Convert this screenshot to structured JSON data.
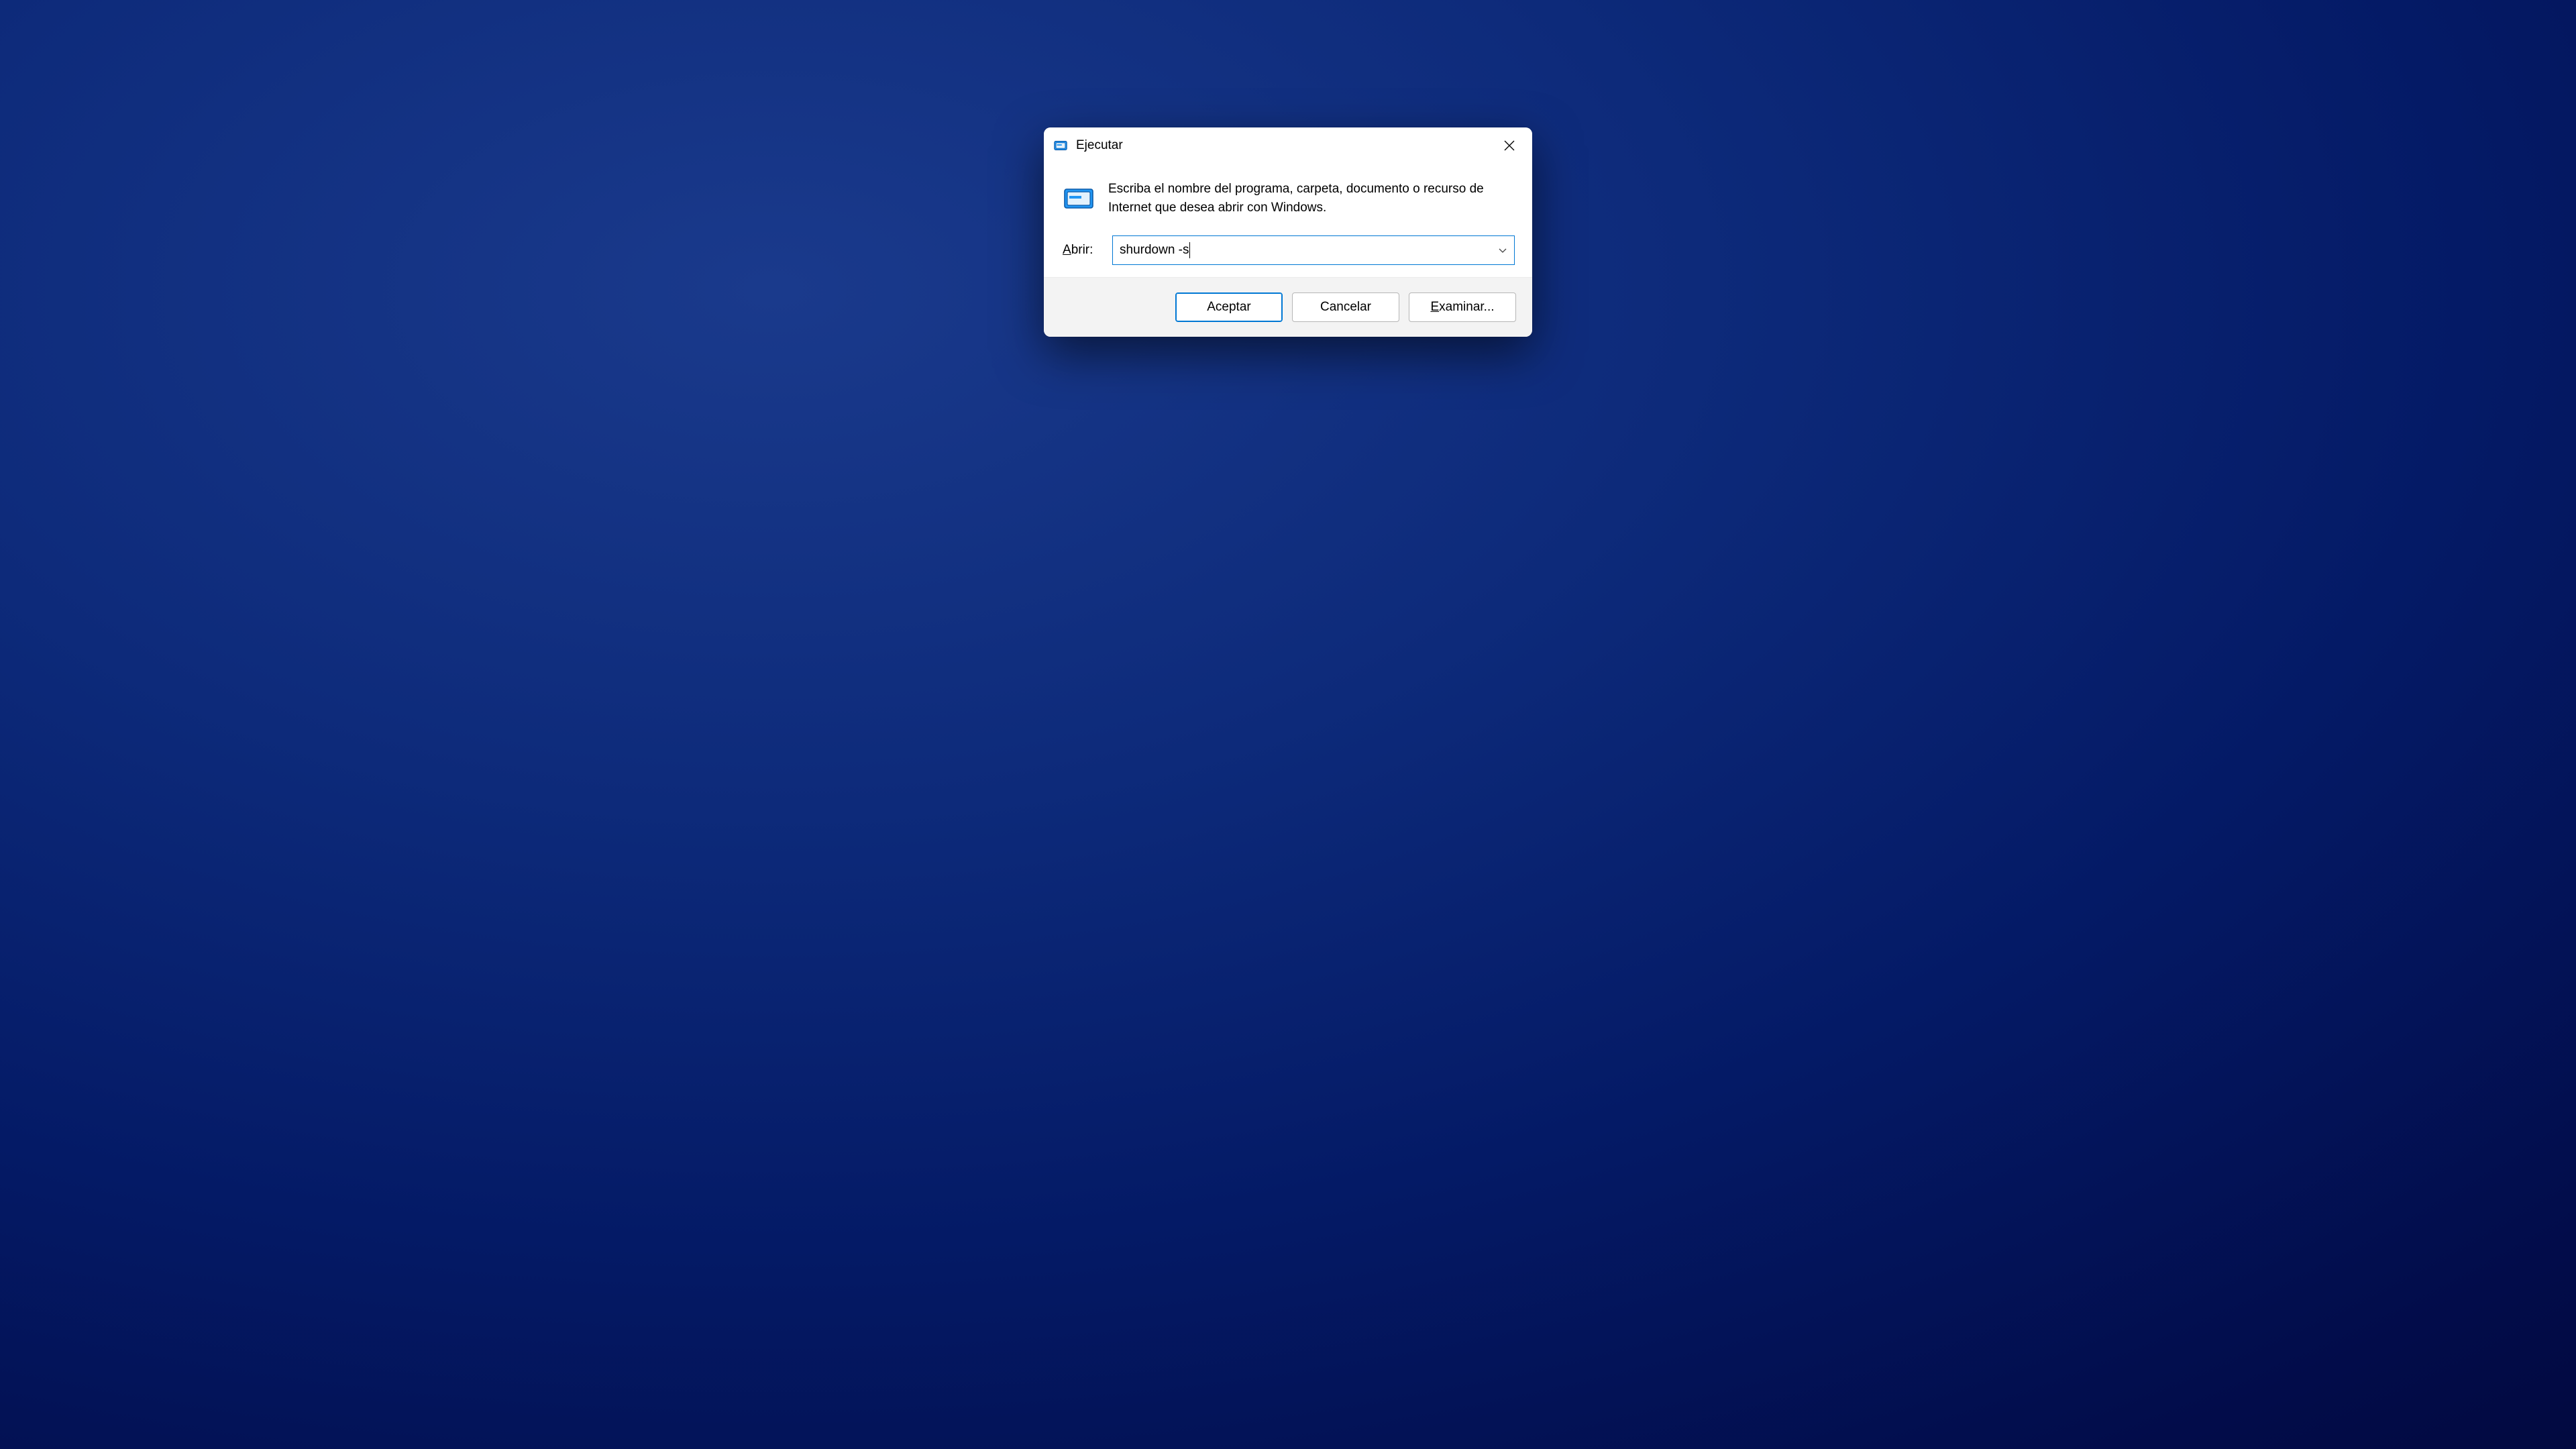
{
  "dialog": {
    "title": "Ejecutar",
    "description": "Escriba el nombre del programa, carpeta, documento o recurso de Internet que desea abrir con Windows.",
    "input_label_underline": "A",
    "input_label_rest": "brir:",
    "input_value": "shurdown -s",
    "buttons": {
      "ok": "Aceptar",
      "cancel": "Cancelar",
      "browse_underline": "E",
      "browse_rest": "xaminar..."
    }
  }
}
